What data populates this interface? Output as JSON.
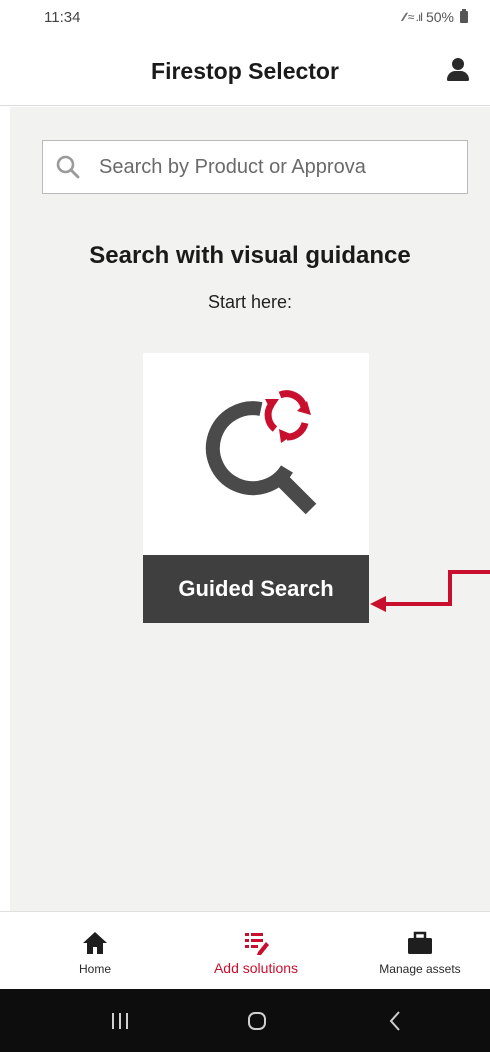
{
  "status_bar": {
    "time": "11:34",
    "signal_icons": "∕∕ ≈ .ıl",
    "battery": "50%"
  },
  "header": {
    "title": "Firestop Selector"
  },
  "search": {
    "placeholder": "Search by Product or Approva"
  },
  "guidance": {
    "title": "Search with visual guidance",
    "subtitle": "Start here:"
  },
  "guided_search": {
    "label": "Guided Search"
  },
  "bottom_nav": {
    "items": [
      {
        "label": "Home",
        "icon": "home-icon"
      },
      {
        "label": "Add solutions",
        "icon": "add-list-icon",
        "active": true
      },
      {
        "label": "Manage assets",
        "icon": "briefcase-icon"
      }
    ]
  },
  "colors": {
    "accent": "#c8102e",
    "dark_bar": "#3f3f3f",
    "background": "#f2f2f1"
  }
}
